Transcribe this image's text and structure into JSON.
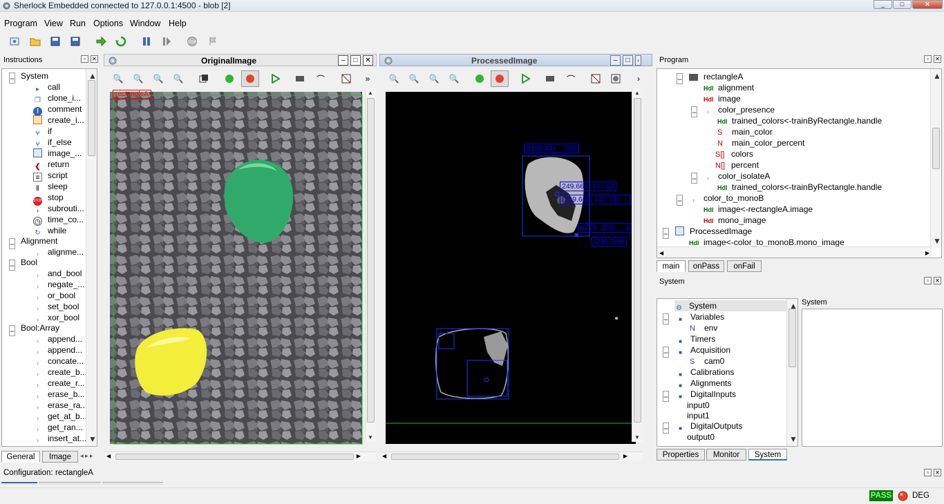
{
  "window": {
    "title": "Sherlock Embedded connected to 127.0.0.1:4500 - blob [2]"
  },
  "menu": {
    "items": [
      "Program",
      "View",
      "Run",
      "Options",
      "Window",
      "Help"
    ]
  },
  "toolbar": {
    "icons": [
      "preferences-icon",
      "open-folder-icon",
      "save-icon",
      "save-as-icon",
      "run-once-icon",
      "run-continuous-icon",
      "pause-icon",
      "step-icon",
      "stop-icon",
      "halt-icon"
    ]
  },
  "instructions": {
    "title": "Instructions",
    "groups": [
      {
        "label": "System",
        "items": [
          "call",
          "clone_i...",
          "comment",
          "create_i...",
          "if",
          "if_else",
          "image_...",
          "return",
          "script",
          "sleep",
          "stop",
          "subrouti...",
          "time_co...",
          "while"
        ]
      },
      {
        "label": "Alignment",
        "items": [
          "alignme..."
        ]
      },
      {
        "label": "Bool",
        "items": [
          "and_bool",
          "negate_...",
          "or_bool",
          "set_bool",
          "xor_bool"
        ]
      },
      {
        "label": "Bool:Array",
        "items": [
          "append...",
          "append...",
          "concate...",
          "create_b...",
          "create_r...",
          "erase_b...",
          "erase_ra...",
          "get_at_b...",
          "get_ran...",
          "insert_at..."
        ]
      }
    ],
    "tabs": [
      "General",
      "Image"
    ]
  },
  "original_image": {
    "title": "OriginalImage",
    "roi_label": "rectangleA"
  },
  "processed_image": {
    "title": "ProcessedImage",
    "labels": [
      "((198,94), ...)(3)",
      "249.666, 147.53",
      "(249.666, 147.53), ...",
      "((276, 209), ...)(3)",
      "(295,269)"
    ]
  },
  "program": {
    "title": "Program",
    "rows": [
      {
        "text": "rectangleA",
        "kind": "node"
      },
      {
        "text": "alignment",
        "kind": "hdl"
      },
      {
        "text": "image",
        "kind": "hdl"
      },
      {
        "text": "color_presence",
        "kind": "sub"
      },
      {
        "text": "trained_colors<-trainByRectangle.handle",
        "kind": "hdl"
      },
      {
        "text": "main_color",
        "kind": "S"
      },
      {
        "text": "main_color_percent",
        "kind": "N"
      },
      {
        "text": "colors",
        "kind": "S[]"
      },
      {
        "text": "percent",
        "kind": "N[]"
      },
      {
        "text": "color_isolateA",
        "kind": "sub"
      },
      {
        "text": "trained_colors<-trainByRectangle.handle",
        "kind": "hdl"
      },
      {
        "text": "color_to_monoB",
        "kind": "sub"
      },
      {
        "text": "image<-rectangleA.image",
        "kind": "hdl"
      },
      {
        "text": "mono_image",
        "kind": "hdl"
      },
      {
        "text": "ProcessedImage",
        "kind": "node"
      },
      {
        "text": "image<-color_to_monoB.mono_image",
        "kind": "hdl"
      }
    ],
    "tabs": [
      "main",
      "onPass",
      "onFail"
    ]
  },
  "system": {
    "title": "System",
    "detail_title": "System",
    "rows": [
      "System",
      "Variables",
      "env",
      "Timers",
      "Acquisition",
      "cam0",
      "Calibrations",
      "Alignments",
      "DigitalInputs",
      "input0",
      "input1",
      "DigitalOutputs",
      "output0"
    ],
    "tabs": [
      "Properties",
      "Monitor",
      "System"
    ]
  },
  "config": {
    "label": "Configuration:",
    "value": "rectangleA"
  },
  "status": {
    "pass": "PASS",
    "deg": "DEG"
  },
  "colors": {
    "pass_bg": "#0a7a0a",
    "accent": "#3b6ea5",
    "roi": "#ff0000",
    "green_ball": "#2faa6a",
    "yellow_ball": "#f2ee3a"
  }
}
